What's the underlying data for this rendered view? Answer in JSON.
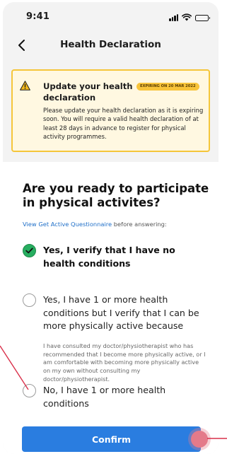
{
  "status_bar": {
    "time": "9:41"
  },
  "header": {
    "title": "Health Declaration"
  },
  "warning": {
    "title": "Update your health declaration",
    "badge": "EXPIRING ON 20 MAR 2022",
    "body": "Please update your health declaration as it is expiring soon. You will require a valid health declaration of at least 28 days in advance to register for physical activity programmes."
  },
  "question": {
    "title": "Are you ready to participate in physical activites?",
    "link_text": "View Get Active Questionnaire",
    "link_suffix": " before answering:"
  },
  "options": [
    {
      "label": "Yes, I verify that I have no health conditions",
      "selected": true
    },
    {
      "label": "Yes, I have 1 or more health conditions but I verify that I can be more physically active because",
      "note": "I have consulted my doctor/physiotherapist who has recommended that I become more physically active, or I am comfortable with becoming more physically active on my own without consulting my doctor/physiotherapist.",
      "selected": false
    },
    {
      "label": "No, I have 1 or more health conditions",
      "selected": false
    }
  ],
  "confirm_label": "Confirm",
  "colors": {
    "primary": "#2a7de0",
    "warning_border": "#f5c63a",
    "warning_bg": "#fff8e1",
    "selected_green": "#27ae60",
    "annotation_red": "#d9304a"
  },
  "icons": [
    "back-chevron-icon",
    "warning-triangle-icon",
    "check-icon",
    "signal-icon",
    "wifi-icon",
    "battery-icon"
  ]
}
